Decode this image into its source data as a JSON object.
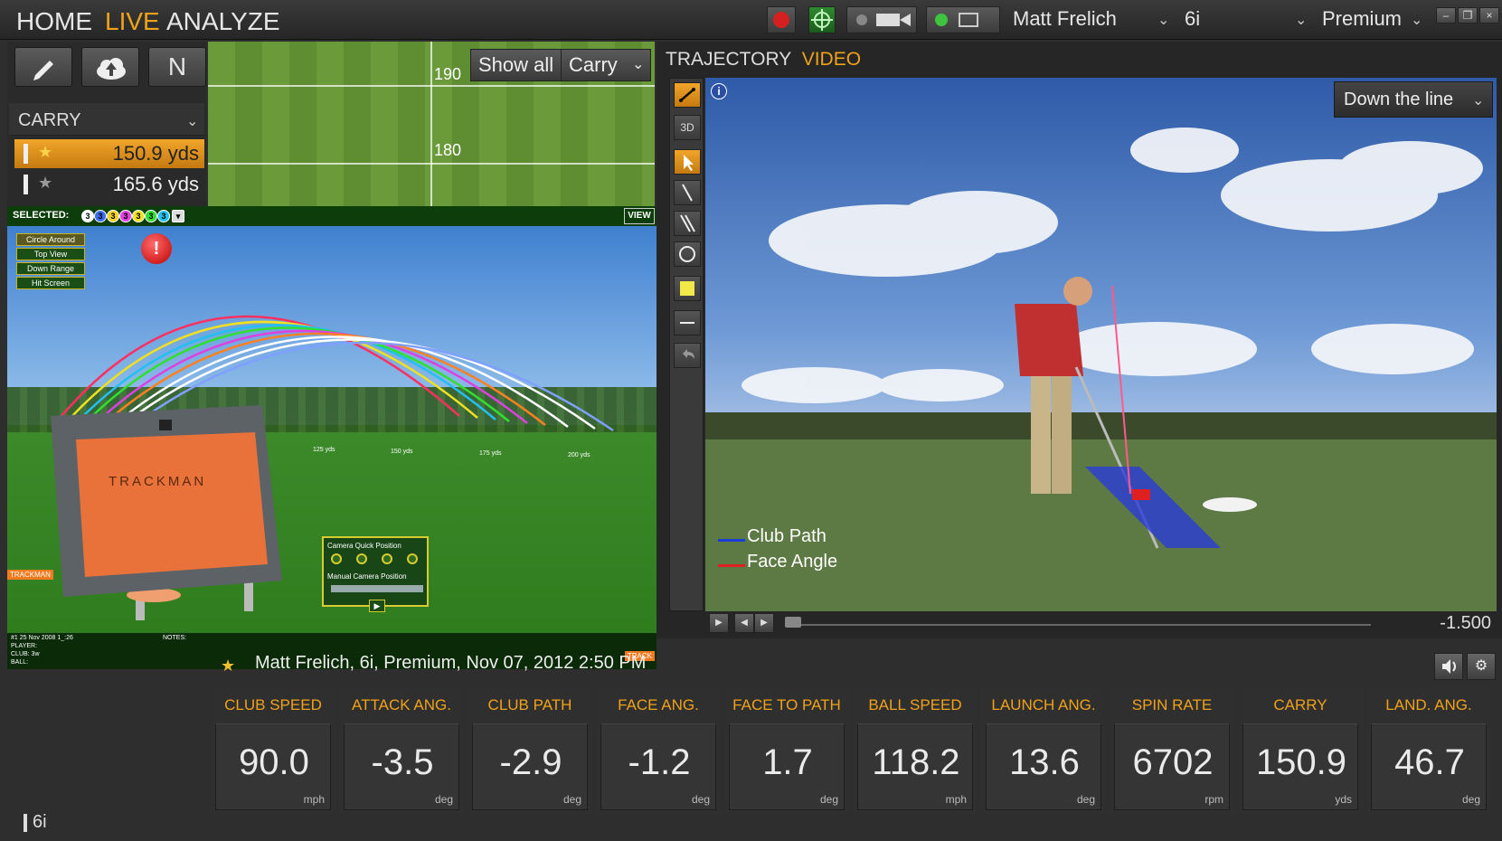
{
  "nav": {
    "home": "HOME",
    "live": "LIVE",
    "analyze": "ANALYZE"
  },
  "topbar": {
    "player": "Matt Frelich",
    "club": "6i",
    "ball": "Premium",
    "window_buttons": [
      "minimize",
      "restore",
      "close"
    ]
  },
  "left_panel": {
    "tools": [
      {
        "icon": "pencil-icon",
        "label": ""
      },
      {
        "icon": "cloud-upload-icon",
        "label": ""
      },
      {
        "icon": "n-icon",
        "label": "N"
      }
    ],
    "dropdown": "CARRY",
    "shots": [
      {
        "value": "150.9 yds",
        "selected": true
      },
      {
        "value": "165.6 yds",
        "selected": false
      }
    ]
  },
  "range_strip": {
    "show_all": "Show all",
    "metric": "Carry",
    "labels": [
      "190",
      "180"
    ]
  },
  "trajectory3d": {
    "selected_label": "SELECTED:",
    "selected_numbers": [
      "3",
      "3",
      "3",
      "3",
      "3",
      "3",
      "3"
    ],
    "view_button": "VIEW",
    "camera_buttons": [
      "Circle Around",
      "Top View",
      "Down Range",
      "Hit Screen"
    ],
    "yard_labels": [
      "125 yds",
      "150 yds",
      "175 yds",
      "200 yds"
    ],
    "camera_box": {
      "title": "Camera Quick Position",
      "manual": "Manual Camera Position"
    },
    "device_brand": "TRACKMAN",
    "notes": {
      "shot": "#1   25 Nov 2008 1_:26",
      "player": "PLAYER:",
      "club": "CLUB: 3w",
      "ball": "BALL:",
      "notes": "NOTES:"
    },
    "trackman_tag_left": "TRACKMAN",
    "trackman_tag_right": "TRACK"
  },
  "right_panel": {
    "tab_trajectory": "TRAJECTORY",
    "tab_video": "VIDEO",
    "view_select": "Down the line",
    "legend": [
      {
        "label": "Club Path",
        "color": "#1a3cd8"
      },
      {
        "label": "Face Angle",
        "color": "#e02020"
      }
    ],
    "tools": [
      "line-icon",
      "3d-icon",
      "pointer-icon",
      "line-draw-icon",
      "double-line-icon",
      "circle-icon",
      "square-icon",
      "minus-icon",
      "undo-icon"
    ],
    "tool_3d_label": "3D",
    "time": "-1.500"
  },
  "session": {
    "text": "Matt Frelich, 6i, Premium, Nov 07, 2012 2:50 PM"
  },
  "stats": [
    {
      "head": "CLUB SPEED",
      "value": "90.0",
      "unit": "mph"
    },
    {
      "head": "ATTACK ANG.",
      "value": "-3.5",
      "unit": "deg"
    },
    {
      "head": "CLUB PATH",
      "value": "-2.9",
      "unit": "deg"
    },
    {
      "head": "FACE ANG.",
      "value": "-1.2",
      "unit": "deg"
    },
    {
      "head": "FACE TO PATH",
      "value": "1.7",
      "unit": "deg"
    },
    {
      "head": "BALL SPEED",
      "value": "118.2",
      "unit": "mph"
    },
    {
      "head": "LAUNCH ANG.",
      "value": "13.6",
      "unit": "deg"
    },
    {
      "head": "SPIN RATE",
      "value": "6702",
      "unit": "rpm"
    },
    {
      "head": "CARRY",
      "value": "150.9",
      "unit": "yds"
    },
    {
      "head": "LAND. ANG.",
      "value": "46.7",
      "unit": "deg"
    }
  ],
  "footer": {
    "club": "6i"
  }
}
